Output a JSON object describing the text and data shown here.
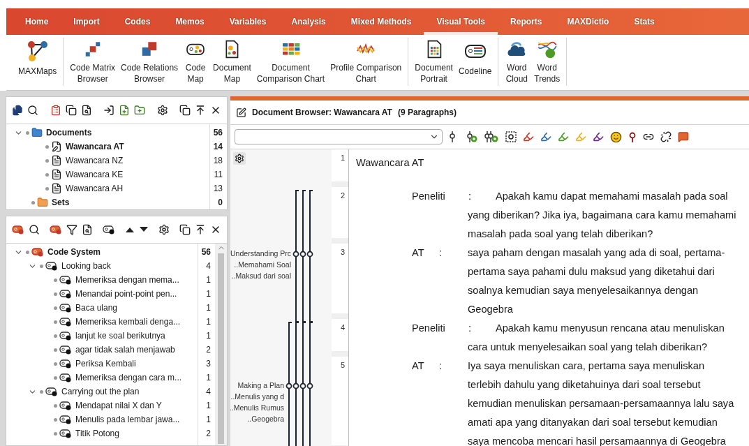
{
  "menu": [
    {
      "label": "Home",
      "selected": false
    },
    {
      "label": "Import",
      "selected": false
    },
    {
      "label": "Codes",
      "selected": false
    },
    {
      "label": "Memos",
      "selected": false
    },
    {
      "label": "Variables",
      "selected": false
    },
    {
      "label": "Analysis",
      "selected": false
    },
    {
      "label": "Mixed Methods",
      "selected": false
    },
    {
      "label": "Visual Tools",
      "selected": true
    },
    {
      "label": "Reports",
      "selected": false
    },
    {
      "label": "MAXDictio",
      "selected": false
    },
    {
      "label": "Stats",
      "selected": false
    }
  ],
  "ribbon": {
    "groups": [
      {
        "items": [
          {
            "label": "MAXMaps",
            "kind": "maxmaps"
          }
        ]
      },
      {
        "items": [
          {
            "label": "Code Matrix\nBrowser",
            "kind": "matrix"
          },
          {
            "label": "Code Relations\nBrowser",
            "kind": "relations"
          },
          {
            "label": "Code\nMap",
            "kind": "codemap"
          },
          {
            "label": "Document\nMap",
            "kind": "docmap"
          },
          {
            "label": "Document\nComparison Chart",
            "kind": "comparison"
          },
          {
            "label": "Profile Comparison\nChart",
            "kind": "profile"
          }
        ]
      },
      {
        "items": [
          {
            "label": "Document\nPortrait",
            "kind": "portrait"
          },
          {
            "label": "Codeline",
            "kind": "codeline"
          }
        ]
      },
      {
        "items": [
          {
            "label": "Word\nCloud",
            "kind": "cloud"
          },
          {
            "label": "Word\nTrends",
            "kind": "trends"
          }
        ]
      }
    ]
  },
  "documents_panel": {
    "tree": {
      "label": "Documents",
      "count": "56",
      "expanded": true,
      "children": [
        {
          "label": "Wawancara AT",
          "count": "14",
          "open": true
        },
        {
          "label": "Wawancara NZ",
          "count": "18",
          "open": false
        },
        {
          "label": "Wawancara KE",
          "count": "11",
          "open": false
        },
        {
          "label": "Wawancara AH",
          "count": "13",
          "open": false
        }
      ]
    },
    "sets": {
      "label": "Sets",
      "count": "0"
    }
  },
  "codes_panel": {
    "tree": {
      "label": "Code System",
      "count": "56",
      "expanded": true,
      "children": [
        {
          "label": "Looking back",
          "count": "4",
          "expanded": true,
          "children": [
            {
              "label": "Memeriksa dengan mema...",
              "count": "1"
            },
            {
              "label": "Menandai point-point pen...",
              "count": "1"
            },
            {
              "label": "Baca ulang",
              "count": "1"
            },
            {
              "label": "Memeriksa kembali denga...",
              "count": "1"
            },
            {
              "label": "lanjut ke soal berikutnya",
              "count": "1"
            },
            {
              "label": "agar tidak salah menjawab",
              "count": "2"
            },
            {
              "label": "Periksa Kembali",
              "count": "3"
            },
            {
              "label": "Memeriksa dengan cara m...",
              "count": "1"
            }
          ]
        },
        {
          "label": "Carrying out the plan",
          "count": "4",
          "expanded": true,
          "children": [
            {
              "label": "Mendapat nilai X dan Y",
              "count": "1"
            },
            {
              "label": "Menulis pada lembar jawa...",
              "count": "1"
            },
            {
              "label": "Titik Potong",
              "count": "2"
            }
          ]
        }
      ]
    }
  },
  "document_browser": {
    "title": "Document Browser: Wawancara AT",
    "subtitle": "(9 Paragraphs)",
    "paragraphs": [
      {
        "number": "1",
        "kind": "title",
        "lines": [
          "Wawancara AT"
        ]
      },
      {
        "number": "2",
        "kind": "question",
        "speaker": "Peneliti",
        "separator": ":",
        "coding": {
          "labels": [
            "Understanding Prc",
            "..Memahami Soal",
            "..Maksud dari soal"
          ]
        },
        "lines": [
          "Apakah kamu dapat memahami masalah pada soal",
          "yang diberikan? Jika iya, bagaimana cara kamu memahami",
          "masalah pada soal yang telah diberikan?"
        ]
      },
      {
        "number": "3",
        "kind": "answer",
        "speaker": "AT",
        "separator": ":",
        "lines": [
          "saya paham dengan masalah yang ada di soal, pertama-",
          "pertama saya pahami dulu maksud yang diketahui dari",
          "soalnya kemudian saya menyelesaikannya dengan",
          "Geogebra"
        ]
      },
      {
        "number": "4",
        "kind": "question",
        "speaker": "Peneliti",
        "separator": ":",
        "coding": {
          "labels": [
            "Making a Plan",
            "..Menulis yang d",
            "..Menulis Rumus",
            "..Geogebra"
          ]
        },
        "lines": [
          "Apakah kamu menyusun rencana atau menuliskan",
          "cara untuk menyelesaikan soal yang telah diberikan?"
        ]
      },
      {
        "number": "5",
        "kind": "answer",
        "speaker": "AT",
        "separator": ":",
        "lines": [
          "Iya saya menuliskan cara, pertama saya menuliskan",
          "terlebih dahulu yang diketahuinya dari soal tersebut",
          "kemudian menuliskan persamaan-persamaannya lalu saya",
          "amati apa yang ditanyakan dari soal tersebut kemudian",
          "saya mencoba mencari hasil persamaannya di Geogebra"
        ]
      }
    ]
  }
}
